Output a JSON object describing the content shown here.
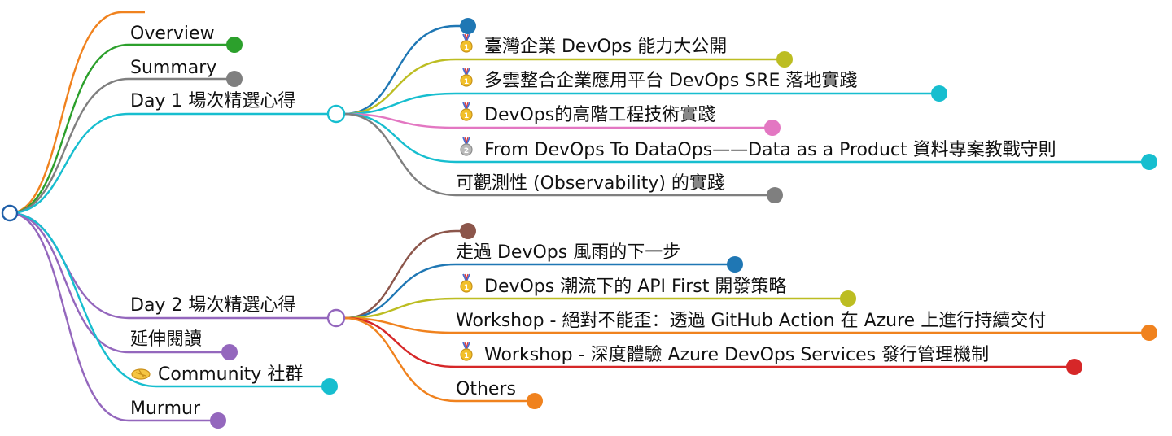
{
  "colors": {
    "orange": "#f0821e",
    "green": "#2ca02c",
    "gray": "#7f7f7f",
    "cyan": "#17becf",
    "purple": "#9467bd",
    "blue": "#1f77b4",
    "olive": "#bcbd22",
    "pink": "#e377c2",
    "brown": "#8c564b",
    "red": "#d62728"
  },
  "root": {
    "icon": "root-node-circle"
  },
  "top_nodes": [
    {
      "id": "blank",
      "label": "",
      "color": "orange"
    },
    {
      "id": "overview",
      "label": "Overview",
      "color": "green"
    },
    {
      "id": "summary",
      "label": "Summary",
      "color": "gray"
    },
    {
      "id": "day1",
      "label": "Day 1 場次精選心得",
      "color": "cyan",
      "expandable": true
    },
    {
      "id": "day2",
      "label": "Day 2 場次精選心得",
      "color": "purple",
      "expandable": true
    },
    {
      "id": "reading",
      "label": "延伸閱讀",
      "color": "purple"
    },
    {
      "id": "community",
      "label": "Community 社群",
      "color": "cyan",
      "icon": "handshake-icon"
    },
    {
      "id": "murmur",
      "label": "Murmur",
      "color": "purple"
    }
  ],
  "day1_children": [
    {
      "label": "",
      "color": "blue"
    },
    {
      "label": "臺灣企業 DevOps 能力大公開",
      "color": "olive",
      "icon": "gold-medal-icon"
    },
    {
      "label": "多雲整合企業應用平台 DevOps SRE 落地實踐",
      "color": "cyan",
      "icon": "gold-medal-icon"
    },
    {
      "label": "DevOps的高階工程技術實踐",
      "color": "pink",
      "icon": "gold-medal-icon"
    },
    {
      "label": "From DevOps To DataOps——Data as a Product 資料專案教戰守則",
      "color": "cyan",
      "icon": "silver-medal-icon"
    },
    {
      "label": "可觀測性 (Observability) 的實踐",
      "color": "gray"
    }
  ],
  "day2_children": [
    {
      "label": "",
      "color": "brown"
    },
    {
      "label": "走過 DevOps 風雨的下一步",
      "color": "blue"
    },
    {
      "label": "DevOps 潮流下的 API First 開發策略",
      "color": "olive",
      "icon": "gold-medal-icon"
    },
    {
      "label": "Workshop - 絕對不能歪：透過 GitHub Action 在 Azure 上進行持續交付",
      "color": "orange"
    },
    {
      "label": "Workshop - 深度體驗 Azure DevOps Services 發行管理機制",
      "color": "red",
      "icon": "gold-medal-icon"
    },
    {
      "label": "Others",
      "color": "orange"
    }
  ]
}
